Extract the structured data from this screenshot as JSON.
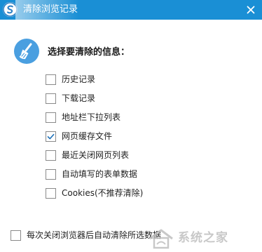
{
  "window": {
    "title": "清除浏览记录",
    "title_bar_color": "#1a8fd5",
    "logo_icon": "sogou-browser-logo",
    "close_icon": "close-icon"
  },
  "main": {
    "icon": "broom-icon",
    "heading": "选择要清除的信息：",
    "options": [
      {
        "label": "历史记录",
        "checked": false
      },
      {
        "label": "下载记录",
        "checked": false
      },
      {
        "label": "地址栏下拉列表",
        "checked": false
      },
      {
        "label": "网页缓存文件",
        "checked": true
      },
      {
        "label": "最近关闭网页列表",
        "checked": false
      },
      {
        "label": "自动填写的表单数据",
        "checked": false
      },
      {
        "label": "Cookies(不推荐清除)",
        "checked": false
      }
    ]
  },
  "footer": {
    "auto_clear_label": "每次关闭浏览器后自动清除所选数据",
    "auto_clear_checked": false
  },
  "watermark": {
    "text": "系统之家"
  }
}
